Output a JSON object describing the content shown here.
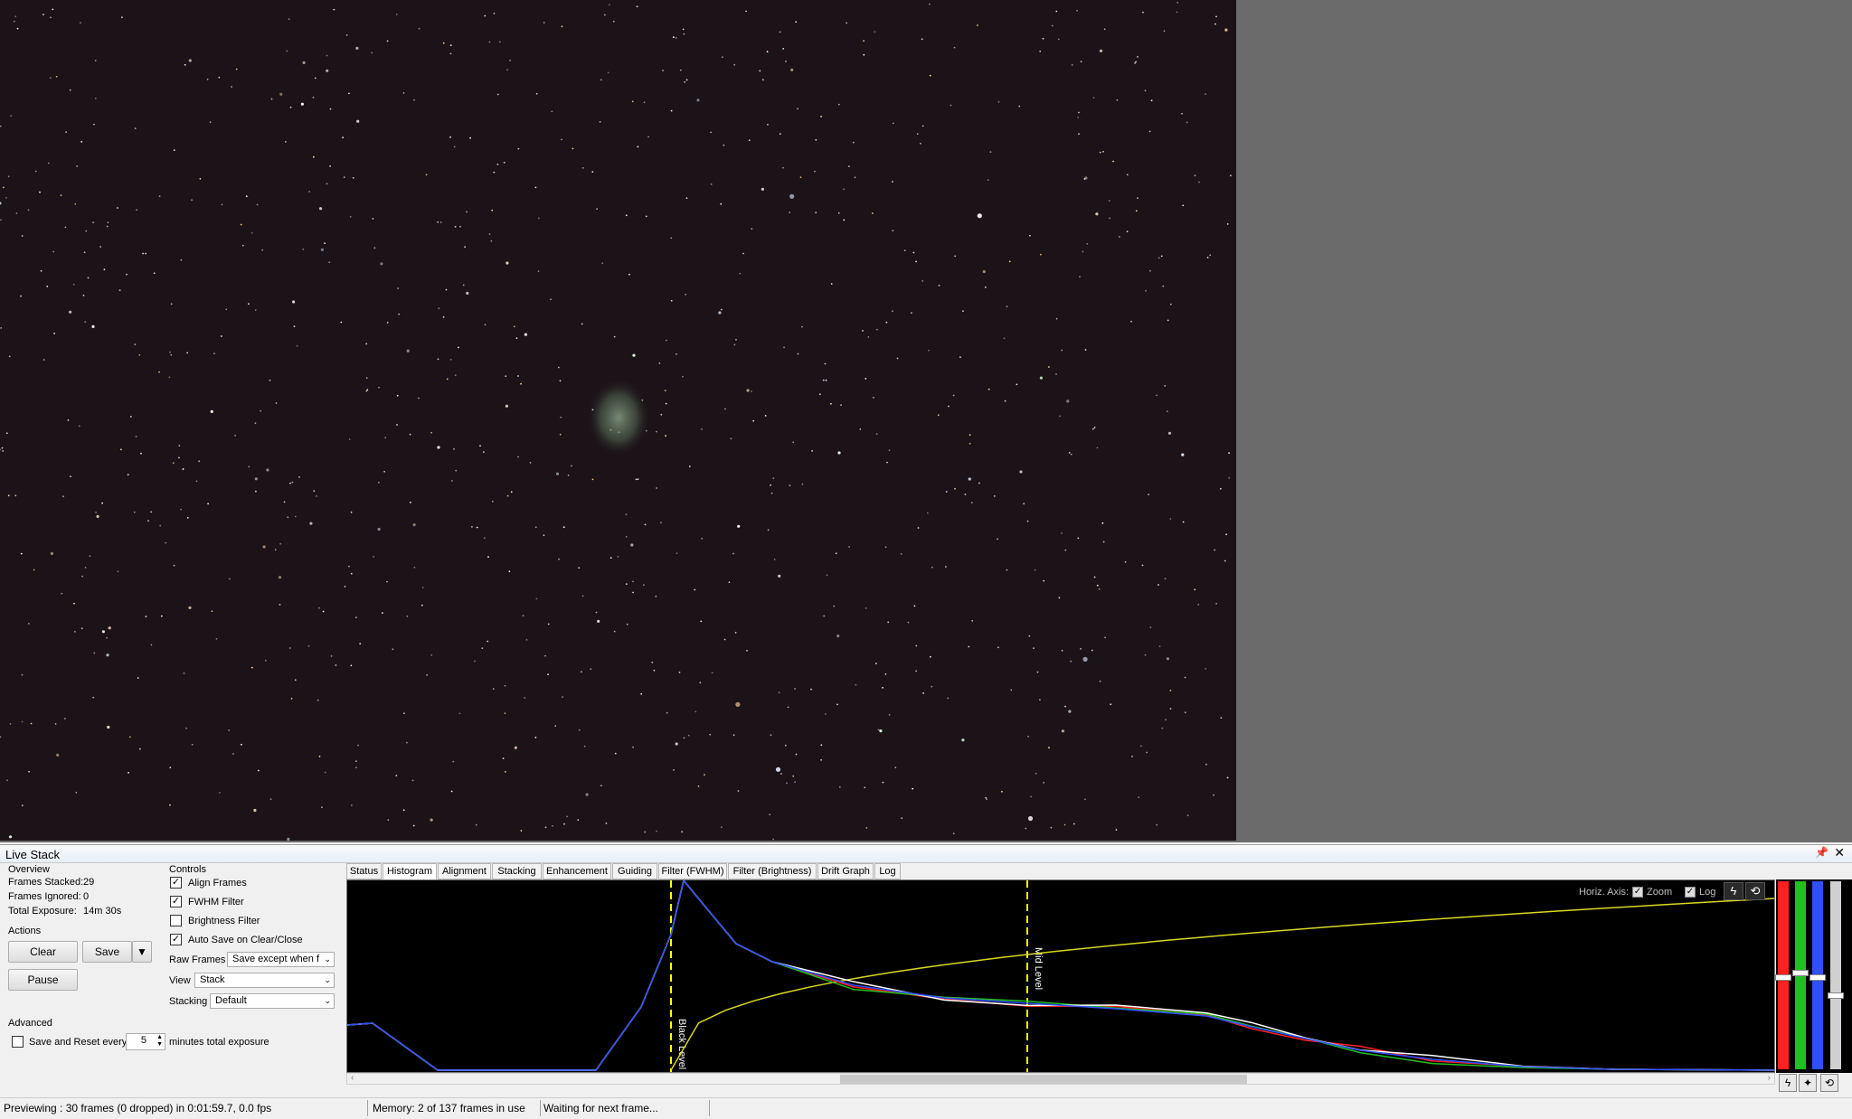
{
  "panel": {
    "title": "Live Stack",
    "pin_icon": "pin-icon",
    "close_icon": "close-icon"
  },
  "overview": {
    "label": "Overview",
    "frames_stacked_label": "Frames Stacked:",
    "frames_stacked_value": "29",
    "frames_ignored_label": "Frames Ignored:",
    "frames_ignored_value": "0",
    "total_exposure_label": "Total Exposure:",
    "total_exposure_value": "14m 30s"
  },
  "actions": {
    "label": "Actions",
    "clear": "Clear",
    "save": "Save",
    "pause": "Pause"
  },
  "controls": {
    "label": "Controls",
    "align_frames": {
      "label": "Align Frames",
      "checked": true
    },
    "fwhm_filter": {
      "label": "FWHM Filter",
      "checked": true
    },
    "brightness_filter": {
      "label": "Brightness Filter",
      "checked": false
    },
    "auto_save": {
      "label": "Auto Save on Clear/Close",
      "checked": true
    },
    "raw_frames_label": "Raw Frames",
    "raw_frames_value": "Save except when f",
    "view_label": "View",
    "view_value": "Stack",
    "stacking_label": "Stacking",
    "stacking_value": "Default"
  },
  "advanced": {
    "label": "Advanced",
    "save_reset_label": "Save and Reset every",
    "save_reset_checked": false,
    "minutes_value": "5",
    "minutes_suffix": "minutes total exposure"
  },
  "tabs": [
    "Status",
    "Histogram",
    "Alignment",
    "Stacking",
    "Enhancement",
    "Guiding",
    "Filter (FWHM)",
    "Filter (Brightness)",
    "Drift Graph",
    "Log"
  ],
  "active_tab": "Histogram",
  "histogram": {
    "horiz_axis_label": "Horiz. Axis:",
    "zoom_label": "Zoom",
    "zoom_checked": true,
    "log_label": "Log",
    "log_checked": true,
    "black_level_label": "Black Level",
    "mid_level_label": "Mid Level",
    "colors": {
      "red": "#ff2020",
      "green": "#20c020",
      "blue": "#3050ff",
      "white": "#ffffff",
      "curve": "#d8d820",
      "level_line": "#ffff00"
    }
  },
  "status_bar": {
    "previewing": "Previewing : 30 frames (0 dropped) in 0:01:59.7, 0.0 fps",
    "memory": "Memory: 2 of 137 frames in use",
    "waiting": "Waiting for next frame..."
  }
}
